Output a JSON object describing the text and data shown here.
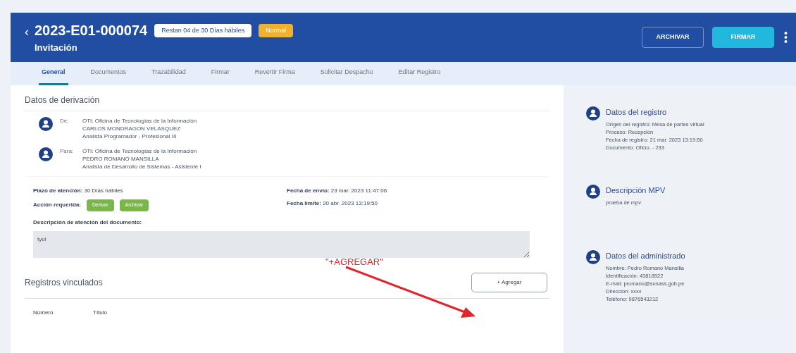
{
  "header": {
    "back": "‹",
    "title": "2023-E01-000074",
    "subtitle": "Invitación",
    "badges": [
      {
        "text": "Restan 04 de 30 Días hábiles",
        "kind": "info"
      },
      {
        "text": "Normal",
        "kind": "priority"
      }
    ],
    "buttons": [
      {
        "label": "ARCHIVAR",
        "kind": "outline"
      },
      {
        "label": "FIRMAR",
        "kind": "primary"
      }
    ]
  },
  "tabs": [
    {
      "label": "General",
      "selected": true
    },
    {
      "label": "Documentos",
      "selected": false
    },
    {
      "label": "Trazabilidad",
      "selected": false
    },
    {
      "label": "Firmar",
      "selected": false
    },
    {
      "label": "Revertir Firma",
      "selected": false
    },
    {
      "label": "Solicitar Despacho",
      "selected": false
    },
    {
      "label": "Editar Registro",
      "selected": false
    }
  ],
  "derivation": {
    "title": "Datos de derivación",
    "parties": [
      {
        "role": "De:",
        "lines": [
          "OTI: Oficina de Tecnologías de la Información",
          "CARLOS MONDRAGON VELASQUEZ",
          "Analista Programador - Profesional III"
        ]
      },
      {
        "role": "Para:",
        "lines": [
          "OTI: Oficina de Tecnologías de la Información",
          "PEDRO ROMANO MANSILLA",
          "Analista de Desarrollo de Sistemas - Asistente I"
        ]
      }
    ],
    "plazo": "**Plazo de atención:** 30 Días hábiles",
    "fecha_envio": "**Fecha de envío:** 23 mar. 2023 11:47:06",
    "accion_label": "Acción requerida:",
    "acciones": [
      "Derivar",
      "Archivar"
    ],
    "fecha_limite": "**Fecha límite:** 20 abr. 2023 13:19:50",
    "descripcion_label": "Descripción de atención del documento:",
    "descripcion_value": "tyui"
  },
  "annotation": {
    "text": "\"+AGREGAR\""
  },
  "linked": {
    "title": "Registros vinculados",
    "add_button": "+ Agregar",
    "columns": [
      "Número",
      "Título"
    ]
  },
  "side_cards": [
    {
      "title": "Datos del registro",
      "lines": [
        "Origen del registro: Mesa de partes virtual",
        "Proceso: Recepción",
        "Fecha de registro: 21 mar. 2023 13:19:50",
        "Documento: Oficio. - 233"
      ]
    },
    {
      "title": "Descripción MPV",
      "lines": [
        "prueba de mpv"
      ]
    },
    {
      "title": "Datos del administrado",
      "lines": [
        "Nombre: Pedro Romano Mansilla",
        "Identificación: 43818522",
        "E-mail: promano@sunass.gob.pe",
        "Dirección: xxxx",
        "Teléfono: 9876543212"
      ]
    }
  ]
}
